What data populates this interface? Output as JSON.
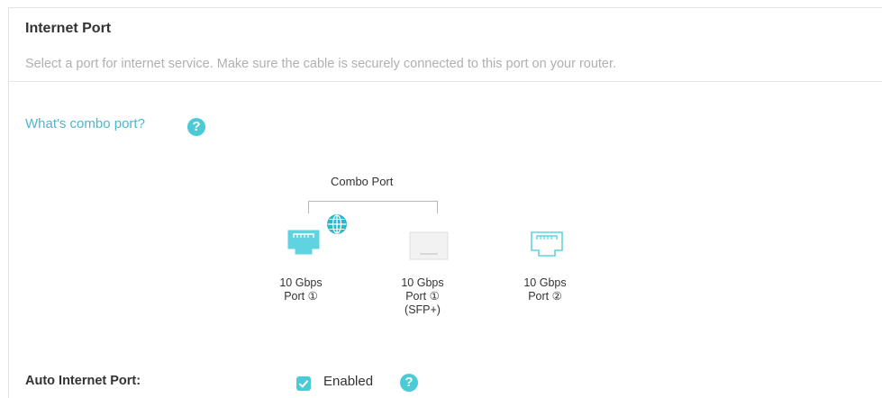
{
  "section": {
    "title": "Internet Port",
    "description": "Select a port for internet service. Make sure the cable is securely connected to this port on your router."
  },
  "combo_help": {
    "link_text": "What's combo port?",
    "icon": "question-icon"
  },
  "diagram": {
    "combo_caption": "Combo Port",
    "ports": [
      {
        "line1": "10 Gbps",
        "line2": "Port ①",
        "line3": "",
        "icon": "ethernet-port-icon",
        "selected": true,
        "badge_icon": "globe-icon"
      },
      {
        "line1": "10 Gbps",
        "line2": "Port ①",
        "line3": "(SFP+)",
        "icon": "sfp-port-icon",
        "selected": false
      },
      {
        "line1": "10 Gbps",
        "line2": "Port ②",
        "line3": "",
        "icon": "ethernet-port-icon",
        "selected": false
      }
    ]
  },
  "auto_internet": {
    "label": "Auto Internet Port:",
    "checked": true,
    "option_label": "Enabled",
    "help_icon": "question-icon"
  },
  "colors": {
    "accent": "#4acbd6",
    "link": "#4db6cc",
    "text": "#333333",
    "muted": "#b0b0b0"
  }
}
